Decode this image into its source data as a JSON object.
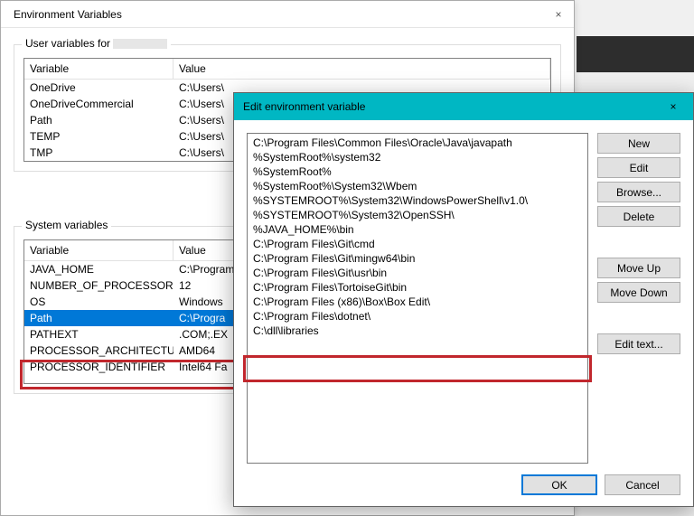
{
  "envDialog": {
    "title": "Environment Variables",
    "close": "×",
    "userGroupLabel": "User variables for",
    "systemGroupLabel": "System variables",
    "columns": {
      "variable": "Variable",
      "value": "Value"
    },
    "userVars": [
      {
        "name": "OneDrive",
        "value": "C:\\Users\\"
      },
      {
        "name": "OneDriveCommercial",
        "value": "C:\\Users\\"
      },
      {
        "name": "Path",
        "value": "C:\\Users\\"
      },
      {
        "name": "TEMP",
        "value": "C:\\Users\\"
      },
      {
        "name": "TMP",
        "value": "C:\\Users\\"
      }
    ],
    "systemVars": [
      {
        "name": "JAVA_HOME",
        "value": "C:\\Program"
      },
      {
        "name": "NUMBER_OF_PROCESSORS",
        "value": "12"
      },
      {
        "name": "OS",
        "value": "Windows"
      },
      {
        "name": "Path",
        "value": "C:\\Progra"
      },
      {
        "name": "PATHEXT",
        "value": ".COM;.EX"
      },
      {
        "name": "PROCESSOR_ARCHITECTURE",
        "value": "AMD64"
      },
      {
        "name": "PROCESSOR_IDENTIFIER",
        "value": "Intel64 Fa"
      }
    ],
    "systemSelectedIndex": 3
  },
  "editDialog": {
    "title": "Edit environment variable",
    "close": "×",
    "entries": [
      "C:\\Program Files\\Common Files\\Oracle\\Java\\javapath",
      "%SystemRoot%\\system32",
      "%SystemRoot%",
      "%SystemRoot%\\System32\\Wbem",
      "%SYSTEMROOT%\\System32\\WindowsPowerShell\\v1.0\\",
      "%SYSTEMROOT%\\System32\\OpenSSH\\",
      "%JAVA_HOME%\\bin",
      "C:\\Program Files\\Git\\cmd",
      "C:\\Program Files\\Git\\mingw64\\bin",
      "C:\\Program Files\\Git\\usr\\bin",
      "C:\\Program Files\\TortoiseGit\\bin",
      "C:\\Program Files (x86)\\Box\\Box Edit\\",
      "C:\\Program Files\\dotnet\\",
      "C:\\dll\\libraries"
    ],
    "buttons": {
      "new": "New",
      "edit": "Edit",
      "browse": "Browse...",
      "delete": "Delete",
      "moveUp": "Move Up",
      "moveDown": "Move Down",
      "editText": "Edit text...",
      "ok": "OK",
      "cancel": "Cancel"
    }
  }
}
